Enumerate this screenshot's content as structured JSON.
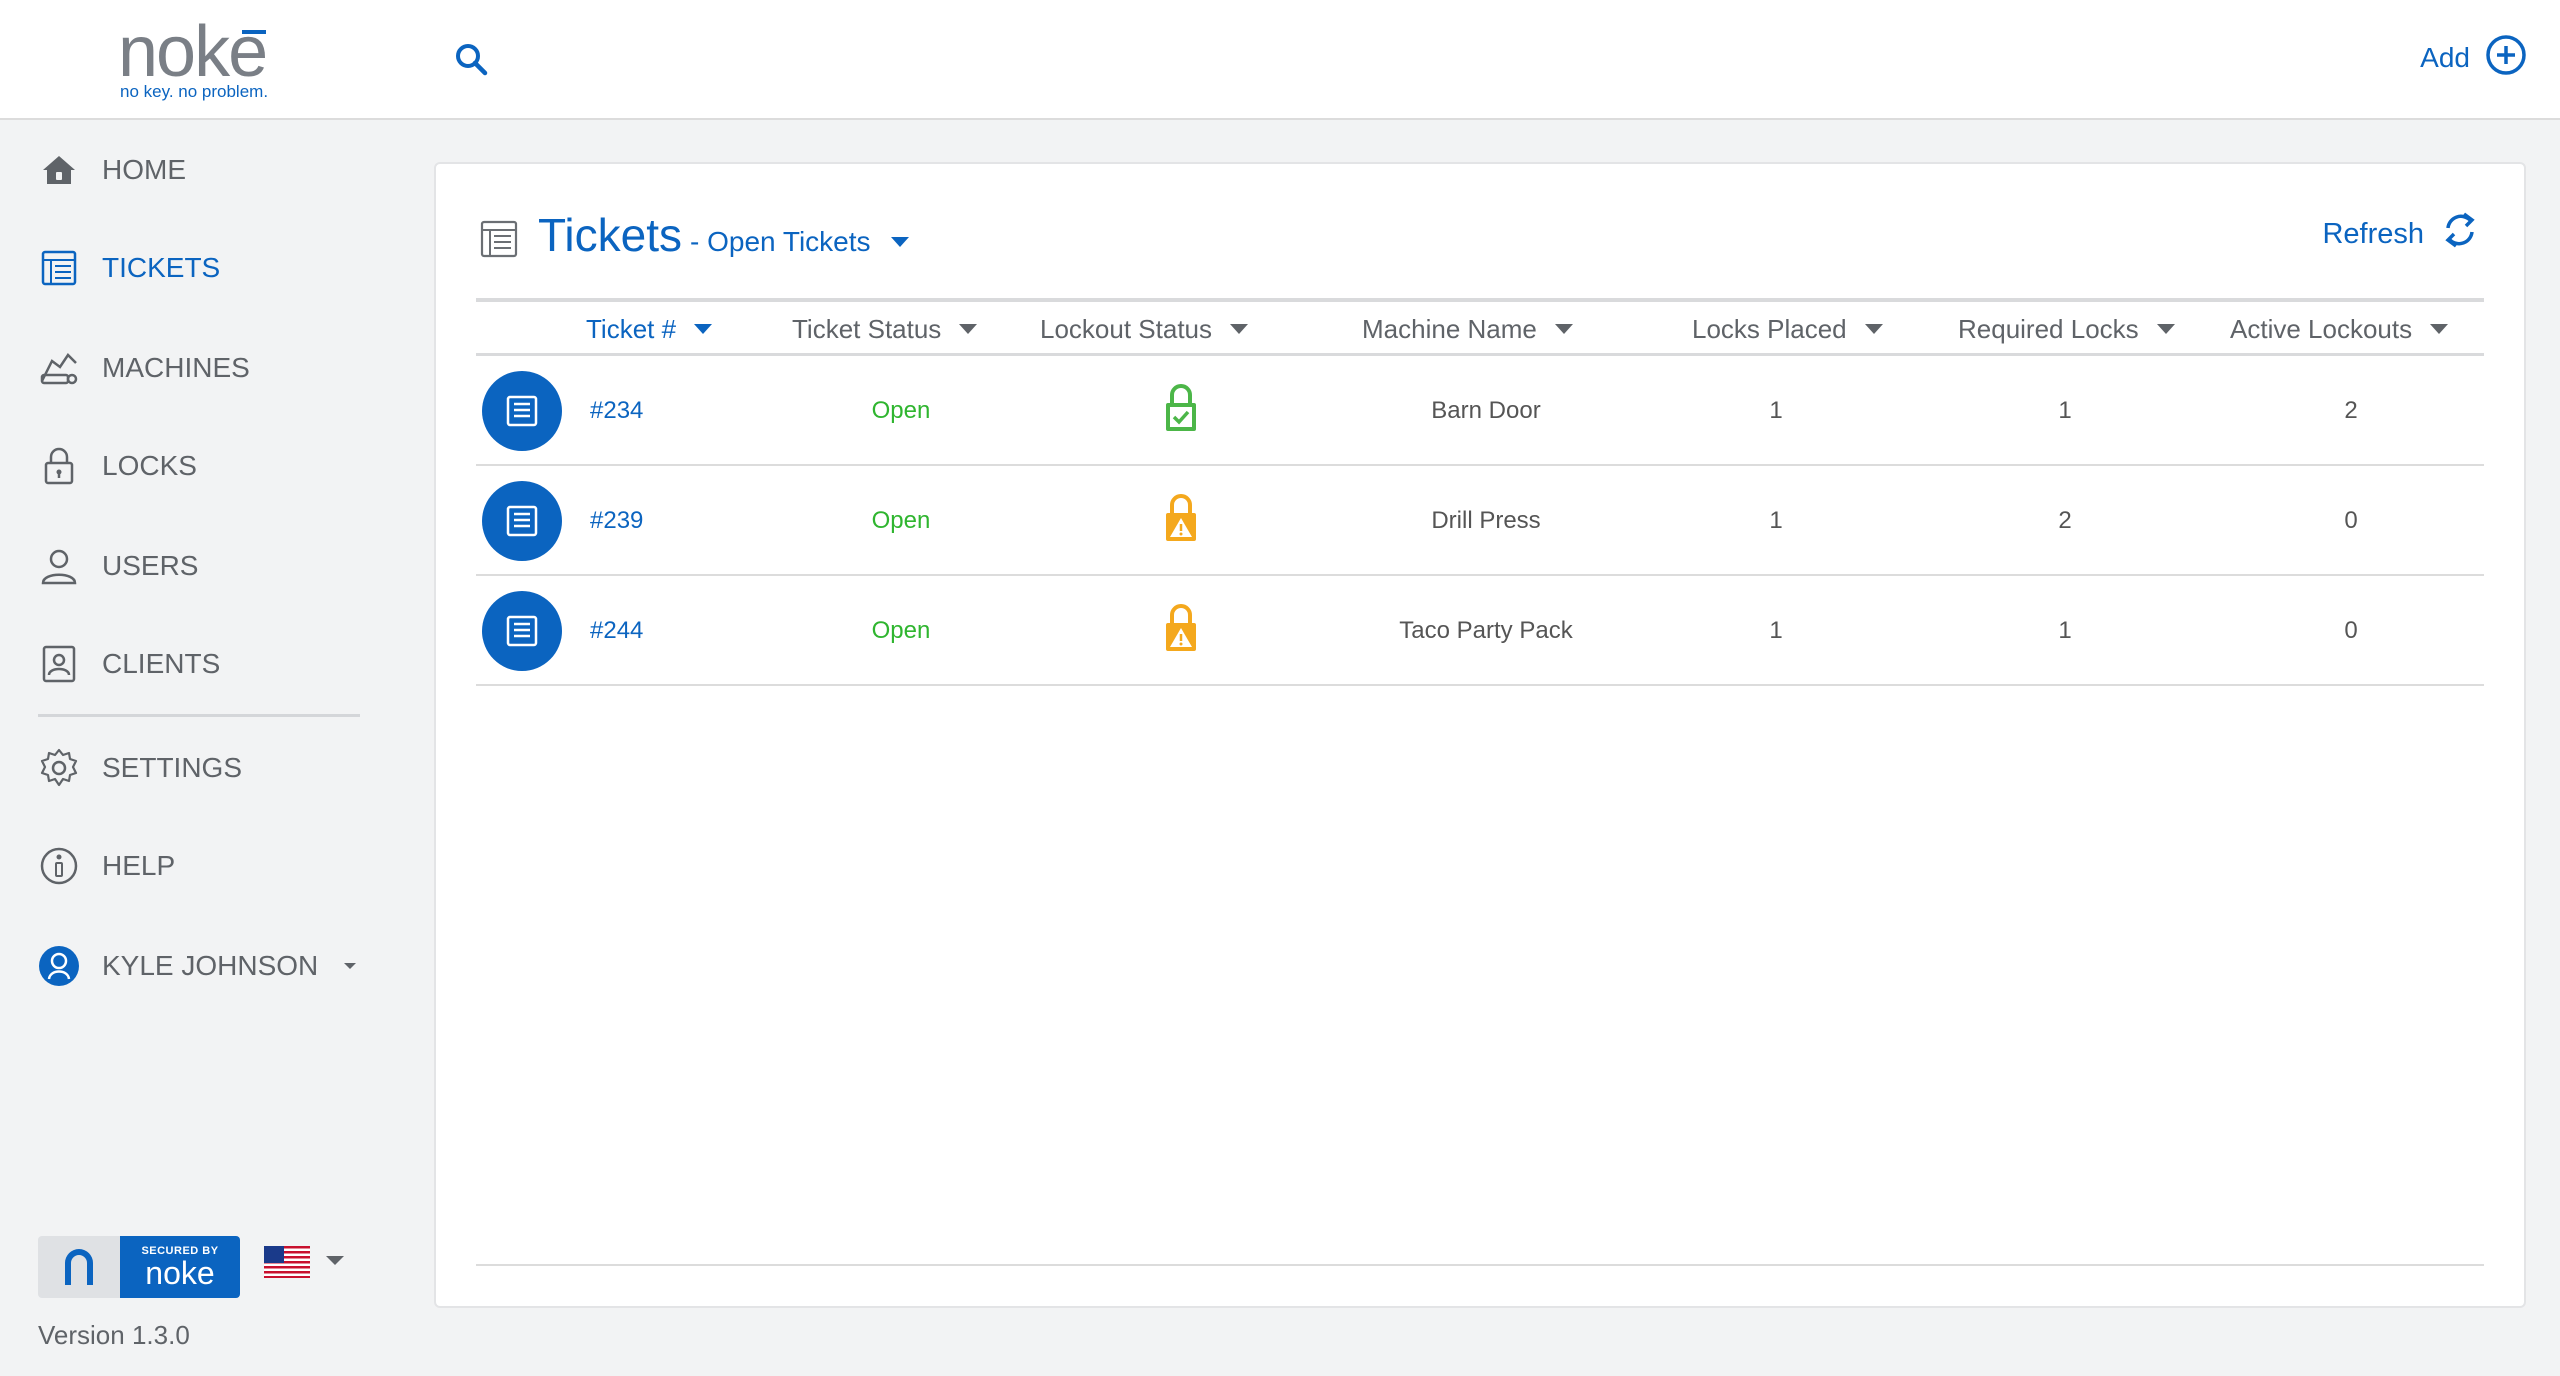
{
  "brand": {
    "logo_word": "noke",
    "tagline": "no key. no problem."
  },
  "header": {
    "add_label": "Add"
  },
  "sidebar": {
    "items": [
      {
        "label": "HOME",
        "icon": "home-icon"
      },
      {
        "label": "TICKETS",
        "icon": "tickets-icon",
        "active": true
      },
      {
        "label": "MACHINES",
        "icon": "machines-icon"
      },
      {
        "label": "LOCKS",
        "icon": "lock-icon"
      },
      {
        "label": "USERS",
        "icon": "user-icon"
      },
      {
        "label": "CLIENTS",
        "icon": "clients-icon"
      }
    ],
    "bottom_items": [
      {
        "label": "SETTINGS",
        "icon": "gear-icon"
      },
      {
        "label": "HELP",
        "icon": "info-icon"
      }
    ],
    "user": {
      "name": "KYLE JOHNSON"
    },
    "secured": {
      "line1": "SECURED BY",
      "line2": "noke"
    },
    "version": "Version 1.3.0"
  },
  "page": {
    "title": "Tickets",
    "filter": "- Open Tickets",
    "refresh_label": "Refresh"
  },
  "table": {
    "columns": [
      "Ticket #",
      "Ticket Status",
      "Lockout Status",
      "Machine Name",
      "Locks Placed",
      "Required Locks",
      "Active Lockouts"
    ],
    "rows": [
      {
        "ticket": "#234",
        "status": "Open",
        "lockout": "locked-ok",
        "machine": "Barn Door",
        "placed": "1",
        "required": "1",
        "active": "2"
      },
      {
        "ticket": "#239",
        "status": "Open",
        "lockout": "warning",
        "machine": "Drill Press",
        "placed": "1",
        "required": "2",
        "active": "0"
      },
      {
        "ticket": "#244",
        "status": "Open",
        "lockout": "warning",
        "machine": "Taco Party Pack",
        "placed": "1",
        "required": "1",
        "active": "0"
      }
    ]
  },
  "colors": {
    "brand_blue": "#0b64c0",
    "status_open": "#2fb52f",
    "lock_ok": "#4cb648",
    "lock_warn": "#f4a81d"
  }
}
